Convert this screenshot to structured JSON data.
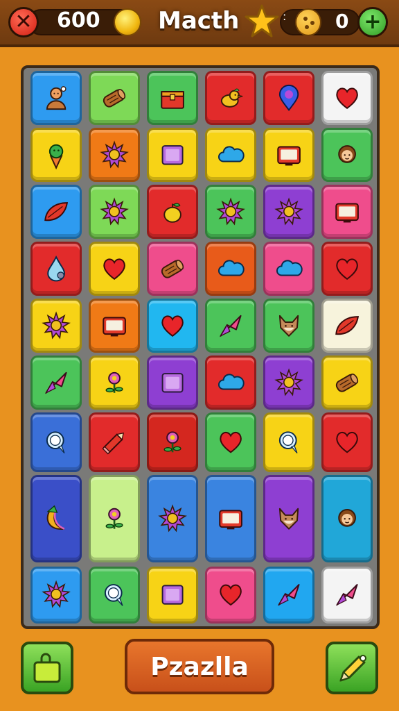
{
  "header": {
    "title": "Macth",
    "score": "600",
    "moves": "0",
    "separator": ":"
  },
  "board": {
    "rows": [
      [
        {
          "color": "#2e9bf0",
          "icon": "person"
        },
        {
          "color": "#7ed957",
          "icon": "log"
        },
        {
          "color": "#4cc45a",
          "icon": "chest"
        },
        {
          "color": "#e22b2b",
          "icon": "bird"
        },
        {
          "color": "#e22b2b",
          "icon": "pin"
        },
        {
          "color": "#f4f4f4",
          "icon": "heart"
        }
      ],
      [
        {
          "color": "#f7d316",
          "icon": "icecream"
        },
        {
          "color": "#f07a16",
          "icon": "sun"
        },
        {
          "color": "#f7d316",
          "icon": "square"
        },
        {
          "color": "#f7d316",
          "icon": "cloud"
        },
        {
          "color": "#f7d316",
          "icon": "tv"
        },
        {
          "color": "#4cc45a",
          "icon": "girl"
        }
      ],
      [
        {
          "color": "#2e9bf0",
          "icon": "leaf"
        },
        {
          "color": "#7ed957",
          "icon": "sun"
        },
        {
          "color": "#e22b2b",
          "icon": "apple"
        },
        {
          "color": "#4cc45a",
          "icon": "sun"
        },
        {
          "color": "#8e3fd2",
          "icon": "sun"
        },
        {
          "color": "#ef4d8c",
          "icon": "tv"
        }
      ],
      [
        {
          "color": "#e22b2b",
          "icon": "drop"
        },
        {
          "color": "#f7d316",
          "icon": "heart"
        },
        {
          "color": "#ef4d8c",
          "icon": "log"
        },
        {
          "color": "#e85b1a",
          "icon": "cloud"
        },
        {
          "color": "#ef4d8c",
          "icon": "cloud"
        },
        {
          "color": "#e22b2b",
          "icon": "heart"
        }
      ],
      [
        {
          "color": "#f7d316",
          "icon": "sun"
        },
        {
          "color": "#f07a16",
          "icon": "tv"
        },
        {
          "color": "#21b7f0",
          "icon": "heart"
        },
        {
          "color": "#4cc45a",
          "icon": "rocket"
        },
        {
          "color": "#4cc45a",
          "icon": "fox"
        },
        {
          "color": "#f7f3dc",
          "icon": "leaf"
        }
      ],
      [
        {
          "color": "#4cc45a",
          "icon": "rocket"
        },
        {
          "color": "#f7d316",
          "icon": "flower"
        },
        {
          "color": "#8e3fd2",
          "icon": "square"
        },
        {
          "color": "#e22b2b",
          "icon": "cloud"
        },
        {
          "color": "#8e3fd2",
          "icon": "sun"
        },
        {
          "color": "#f7d316",
          "icon": "log"
        }
      ],
      [
        {
          "color": "#3a6fd8",
          "icon": "bubble"
        },
        {
          "color": "#e22b2b",
          "icon": "pencil"
        },
        {
          "color": "#d4271f",
          "icon": "flower"
        },
        {
          "color": "#4cc45a",
          "icon": "heart"
        },
        {
          "color": "#f7d316",
          "icon": "bubble"
        },
        {
          "color": "#e22b2b",
          "icon": "heart"
        }
      ],
      [
        {
          "color": "#3a4fc8",
          "icon": "banana"
        },
        {
          "color": "#c8f08c",
          "icon": "flower"
        },
        {
          "color": "#3a84e0",
          "icon": "sun"
        },
        {
          "color": "#3a84e0",
          "icon": "tv"
        },
        {
          "color": "#8e3fd2",
          "icon": "fox"
        },
        {
          "color": "#21a7d8",
          "icon": "girl"
        }
      ],
      [
        {
          "color": "#2e9bf0",
          "icon": "sun"
        },
        {
          "color": "#4cc45a",
          "icon": "bubble"
        },
        {
          "color": "#f7d316",
          "icon": "square"
        },
        {
          "color": "#ef4d8c",
          "icon": "heart"
        },
        {
          "color": "#21a7f0",
          "icon": "rocket"
        },
        {
          "color": "#f4f4f4",
          "icon": "rocket"
        }
      ]
    ]
  },
  "footer": {
    "play_label": "Pzazlla"
  }
}
